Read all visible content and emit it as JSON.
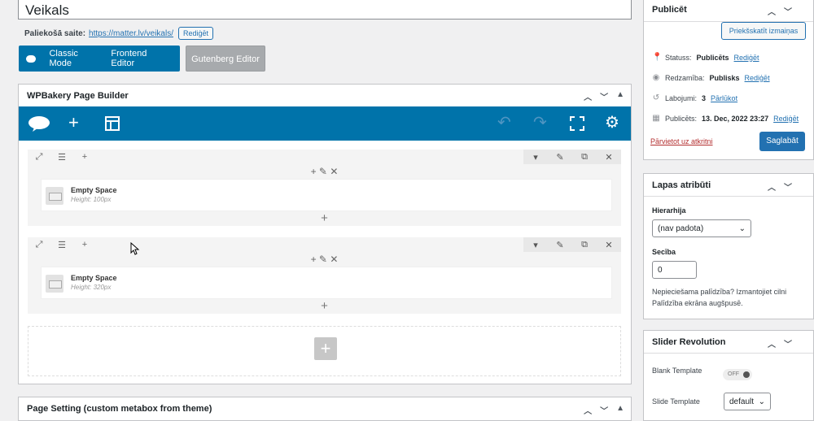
{
  "post": {
    "title": "Veikals",
    "permalink_label": "Paliekošā saite:",
    "permalink_url": "https://matter.lv/veikals/",
    "permalink_edit": "Rediģēt"
  },
  "modes": {
    "classic": "Classic Mode",
    "frontend": "Frontend Editor",
    "gutenberg": "Gutenberg Editor"
  },
  "wpbakery": {
    "title": "WPBakery Page Builder",
    "rows": [
      {
        "element_title": "Empty Space",
        "element_sub": "Height: 100px"
      },
      {
        "element_title": "Empty Space",
        "element_sub": "Height: 320px"
      }
    ]
  },
  "page_setting": {
    "title": "Page Setting (custom metabox from theme)"
  },
  "publish": {
    "title": "Publicēt",
    "preview": "Priekšskatīt izmaiņas",
    "status_label": "Statuss:",
    "status_value": "Publicēts",
    "visibility_label": "Redzamība:",
    "visibility_value": "Publisks",
    "revisions_label": "Labojumi:",
    "revisions_value": "3",
    "revisions_link": "Pārlūkot",
    "published_label": "Publicēts:",
    "published_value": "13. Dec, 2022 23:27",
    "edit": "Rediģēt",
    "trash": "Pārvietot uz atkritni",
    "save": "Saglabāt"
  },
  "attributes": {
    "title": "Lapas atribūti",
    "parent_label": "Hierarhija",
    "parent_value": "(nav padota)",
    "order_label": "Secība",
    "order_value": "0",
    "help": "Nepieciešama palīdzība? Izmantojiet cilni Palīdzība ekrāna augšpusē."
  },
  "slider": {
    "title": "Slider Revolution",
    "blank_label": "Blank Template",
    "blank_toggle": "OFF",
    "slide_template_label": "Slide Template",
    "slide_template_value": "default"
  },
  "colors": {
    "accent": "#0073aa",
    "primary": "#2271b1",
    "danger": "#b32d2e"
  }
}
